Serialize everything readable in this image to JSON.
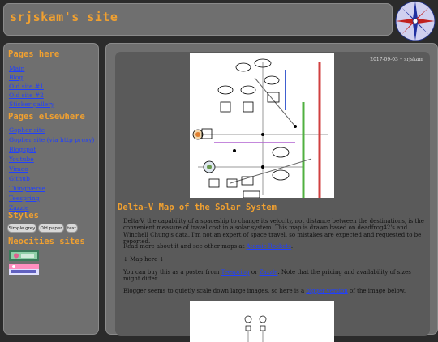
{
  "site": {
    "title": "srjskam's site"
  },
  "sidebar": {
    "pages_here_heading": "Pages here",
    "pages_here": [
      "Main",
      "Blog",
      "Old site #1",
      "Old site #2",
      "Sticker gallery"
    ],
    "pages_elsewhere_heading": "Pages elsewhere",
    "pages_elsewhere": [
      "Gopher site",
      "Gopher site (via http proxy)",
      "Blogspot",
      "Youtube",
      "Vimeo",
      "Github",
      "Thingiverse",
      "Teespring",
      "Zazzle"
    ],
    "styles_heading": "Styles",
    "styles": [
      "Simple grey",
      "Old paper",
      "text"
    ],
    "neocities_heading": "Neocities sites",
    "badges": [
      {
        "label": "neocities-badge-1"
      },
      {
        "label": "neocities-badge-2"
      }
    ]
  },
  "post": {
    "date": "2017-09-03 • srjskam",
    "title": "Delta-V Map of the Solar System",
    "para1": "Delta-V, the capability of a spaceship to change its velocity, not distance between the destinations, is the convenient measure of travel cost in a solar system. This map is drawn based on deadfrog42's and Winchell Chung's data. I'm not an expert of space travel, so mistakes are expected and requested to be reported.",
    "para2_pre": "Read more about it and see other maps at ",
    "para2_link": "Atomic Rockets",
    "para2_post": ".",
    "para3": "↓ Map here ↓",
    "para4_pre": "You can buy this as a poster from ",
    "para4_link1": "Teespring",
    "para4_mid": " or ",
    "para4_link2": "Zazzle",
    "para4_post": ". Note that the pricing and availability of sizes might differ.",
    "para5_pre": "Blogger seems to quietly scale down large images, so here is a ",
    "para5_link": "bigger version",
    "para5_post": " of the image below."
  },
  "colors": {
    "accent": "#f0a030",
    "link": "#2040ff",
    "panel": "#6f6f6f",
    "background": "#2b2b2b"
  }
}
